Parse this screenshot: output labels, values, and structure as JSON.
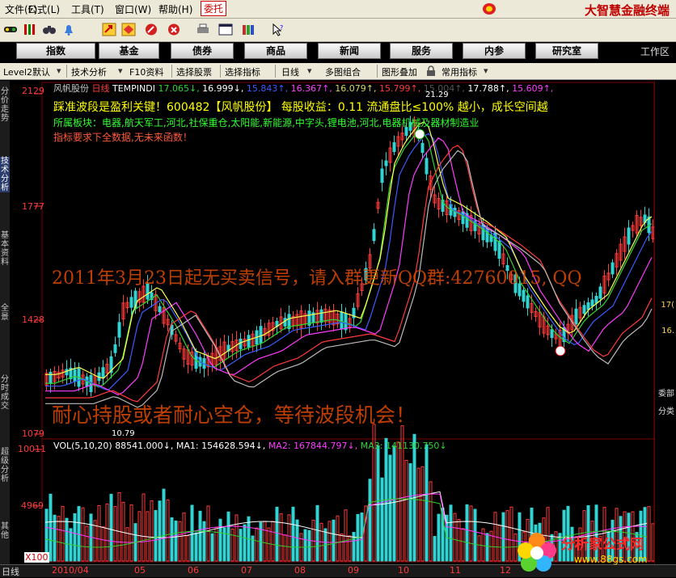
{
  "menu": {
    "items": [
      "文件(F)",
      "公式(L)",
      "工具(T)",
      "窗口(W)",
      "帮助(H)",
      "委托"
    ],
    "brand": "大智慧金融终端"
  },
  "nav": {
    "buttons": [
      "指数",
      "基金",
      "债券",
      "商品",
      "新闻",
      "服务",
      "内参",
      "研究室"
    ],
    "workspace": "工作区"
  },
  "subtoolbar": {
    "items": [
      "Level2默认",
      "技术分析",
      "F10资料",
      "选择股票",
      "选择指标",
      "日线",
      "多图组合",
      "图形叠加",
      "常用指标"
    ]
  },
  "sidebar": {
    "tabs": [
      "分价走势",
      "技术分析",
      "基本资料",
      "全景",
      "分时成交",
      "超级分析",
      "其他"
    ]
  },
  "price_axis": {
    "labels": [
      "2129",
      "1777",
      "1428",
      "1079"
    ]
  },
  "vol_axis": {
    "labels": [
      "10011",
      "4969",
      "X100"
    ]
  },
  "price_info": {
    "name": "风帆股份",
    "period": "日线",
    "indicator": "TEMPINDI",
    "values": [
      {
        "v": "17.065",
        "arrow": "↓",
        "color": "#31d331"
      },
      {
        "v": "16.999",
        "arrow": "↓",
        "color": "#ffffff"
      },
      {
        "v": "15.843",
        "arrow": "↑",
        "color": "#3b5bff"
      },
      {
        "v": "16.367",
        "arrow": "↑",
        "color": "#ff3bff"
      },
      {
        "v": "16.079",
        "arrow": "↑",
        "color": "#d7d76b"
      },
      {
        "v": "15.799",
        "arrow": "↑",
        "color": "#ff3b3b"
      },
      {
        "v": "15.004",
        "arrow": "↑",
        "color": "#555555"
      },
      {
        "v": "17.788",
        "arrow": "↑",
        "color": "#ffffff"
      },
      {
        "v": "15.609",
        "arrow": "↑",
        "color": "#ff3bff"
      }
    ]
  },
  "annotations": {
    "line1": "踩准波段是盈利关键！600482【风帆股份】  每股收益：0.11  流通盘比≤100%  越小，成长空间越",
    "line2": "所属板块：电器,航天军工,河北,社保重仓,太阳能,新能源,中字头,锂电池,河北,电器机械及器材制造业",
    "line3": "指标要求下全数据,无未来函数！",
    "high_label": "21.29",
    "low_label": "10.79"
  },
  "watermarks": {
    "top": "2011年3月23日起无买卖信号，请入群更新QQ群:42760015, QQ",
    "bottom": "耐心持股或者耐心空仓，等待波段机会！"
  },
  "vol_info": {
    "label": "VOL(5,10,20)",
    "vol": "88541.000↓,",
    "ma1": "MA1: 154628.594↓,",
    "ma2": "MA2: 167844.797↓,",
    "ma3": "MA3: 141130.750↓"
  },
  "right_panel": {
    "labels": [
      "17(",
      "16.",
      "委部",
      "分类"
    ]
  },
  "bottom": {
    "tab": "日线",
    "dates": [
      "2010/04",
      "05",
      "06",
      "07",
      "08",
      "09",
      "10",
      "11",
      "12"
    ]
  },
  "logo": {
    "cn": "分析家公式网",
    "url": "www.88gs.com"
  },
  "colors": {
    "up": "#ff3b3b",
    "down": "#31d3d3",
    "ma1": "#ffffff",
    "ma2": "#ffff4d",
    "ma3": "#ff3bff",
    "ma4": "#31d331",
    "ma5": "#3b5bff"
  }
}
